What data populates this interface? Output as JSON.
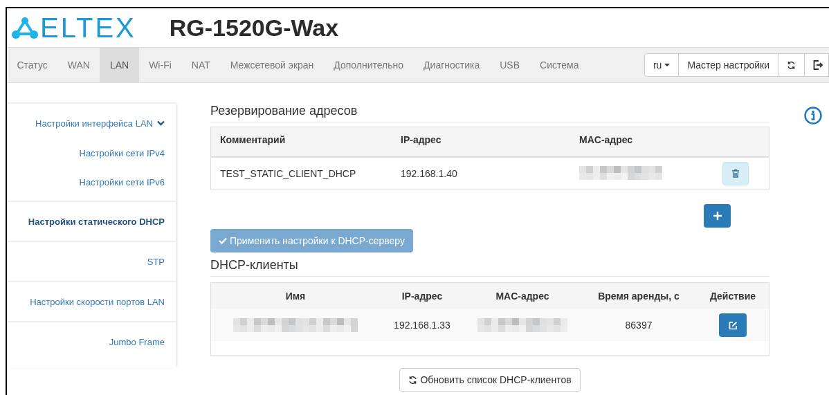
{
  "header": {
    "logo_text": "ELTEX",
    "model": "RG-1520G-Wax"
  },
  "nav": {
    "tabs": [
      {
        "label": "Статус",
        "selected": false
      },
      {
        "label": "WAN",
        "selected": false
      },
      {
        "label": "LAN",
        "selected": true
      },
      {
        "label": "Wi-Fi",
        "selected": false
      },
      {
        "label": "NAT",
        "selected": false
      },
      {
        "label": "Межсетевой экран",
        "selected": false
      },
      {
        "label": "Дополнительно",
        "selected": false
      },
      {
        "label": "Диагностика",
        "selected": false
      },
      {
        "label": "USB",
        "selected": false
      },
      {
        "label": "Система",
        "selected": false
      }
    ],
    "language": "ru",
    "wizard_button": "Мастер настройки"
  },
  "sidebar": {
    "items": [
      {
        "label": "Настройки интерфейса LAN",
        "selected": false,
        "expanded": true,
        "children": [
          {
            "label": "Настройки сети IPv4",
            "selected": false
          },
          {
            "label": "Настройки сети IPv6",
            "selected": false
          }
        ]
      },
      {
        "label": "Настройки статического DHCP",
        "selected": true
      },
      {
        "label": "STP",
        "selected": false
      },
      {
        "label": "Настройки скорости портов LAN",
        "selected": false
      },
      {
        "label": "Jumbo Frame",
        "selected": false
      }
    ]
  },
  "reservations": {
    "title": "Резервирование адресов",
    "columns": [
      "Комментарий",
      "IP-адрес",
      "MAC-адрес"
    ],
    "rows": [
      {
        "cells": [
          {
            "kind": "text",
            "text": "TEST_STATIC_CLIENT_DHCP"
          },
          {
            "kind": "text",
            "text": "192.168.1.40"
          },
          {
            "kind": "redacted"
          }
        ]
      }
    ],
    "apply_button": {
      "label": "Применить настройки к DHCP-серверу",
      "disabled": true
    }
  },
  "clients": {
    "title": "DHCP-клиенты",
    "columns": [
      "Имя",
      "IP-адрес",
      "MAC-адрес",
      "Время аренды, с",
      "Действие"
    ],
    "rows": [
      {
        "cells": [
          {
            "kind": "redacted"
          },
          {
            "kind": "text",
            "text": "192.168.1.33"
          },
          {
            "kind": "redacted"
          },
          {
            "kind": "text",
            "text": "86397"
          }
        ]
      }
    ],
    "refresh_button": "Обновить список DHCP-клиентов"
  }
}
